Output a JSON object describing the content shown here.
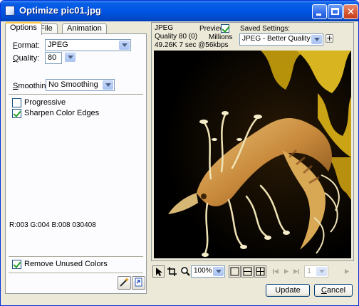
{
  "window": {
    "title": "Optimize pic01.jpg",
    "min_label": "–",
    "max_label": "",
    "close_label": "✕"
  },
  "tabs": [
    "Options",
    "File",
    "Animation"
  ],
  "options": {
    "format_label": "Format:",
    "format_value": "JPEG",
    "quality_label": "Quality:",
    "quality_value": "80",
    "smoothing_label": "Smoothing:",
    "smoothing_value": "No Smoothing",
    "progressive_label": "Progressive",
    "progressive_checked": false,
    "sharpen_label": "Sharpen Color Edges",
    "sharpen_checked": true,
    "color_readout": "R:003 G:004 B:008 030408",
    "remove_unused_label": "Remove Unused Colors",
    "remove_unused_checked": true
  },
  "preview": {
    "format": "JPEG",
    "quality_info": "Quality 80 (0)",
    "size_info": "49.26K  7 sec @56kbps",
    "preview_label": "Preview",
    "preview_checked": true,
    "colors_label": "Millions",
    "saved_settings_label": "Saved Settings:",
    "saved_settings_value": "JPEG - Better Quality",
    "add_label": "+"
  },
  "toolbar": {
    "zoom_value": "100%",
    "frame_value": "1"
  },
  "buttons": {
    "update": "Update",
    "cancel": "Cancel"
  },
  "icons": {
    "pointer": "pointer-icon",
    "crop": "crop-icon",
    "zoom": "magnifier-icon",
    "view_single": "single-view-icon",
    "view_2up": "2-up-view-icon",
    "view_4up": "4-up-view-icon"
  },
  "colors": {
    "title_bar": "#0055e5",
    "window_bg": "#ece9d8",
    "check_green": "#21a121"
  }
}
